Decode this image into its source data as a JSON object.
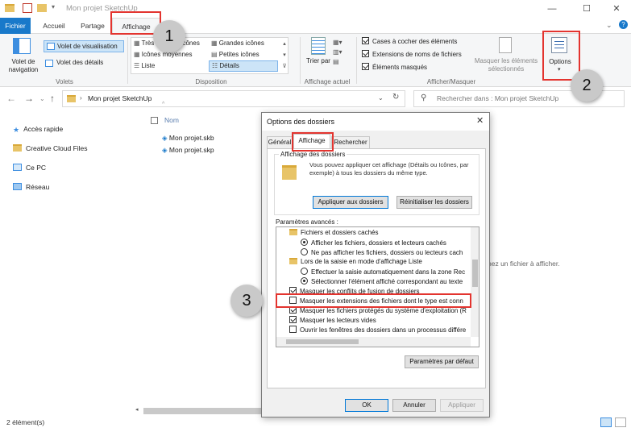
{
  "window": {
    "title": "Mon projet SketchUp",
    "controls": [
      "—",
      "☐",
      "✕"
    ]
  },
  "tabs": [
    "Fichier",
    "Accueil",
    "Partage",
    "Affichage"
  ],
  "ribbon": {
    "volets": {
      "navigation": "Volet de navigation",
      "visualisation": "Volet de visualisation",
      "details": "Volet des détails",
      "group": "Volets"
    },
    "disposition": {
      "items": [
        "Très grandes icônes",
        "Grandes icônes",
        "Icônes moyennes",
        "Petites icônes",
        "Liste",
        "Détails"
      ],
      "group": "Disposition"
    },
    "affichage_actuel": {
      "trier": "Trier par",
      "group": "Affichage actuel"
    },
    "afficher_masquer": {
      "cases": "Cases à cocher des éléments",
      "extensions": "Extensions de noms de fichiers",
      "masques": "Éléments masqués",
      "masquer_selection": "Masquer les éléments sélectionnés",
      "group": "Afficher/Masquer"
    },
    "options": "Options"
  },
  "address": {
    "path": "Mon projet SketchUp",
    "search_placeholder": "Rechercher dans : Mon projet SketchUp"
  },
  "nav": [
    "Accès rapide",
    "Creative Cloud Files",
    "Ce PC",
    "Réseau"
  ],
  "files": {
    "column": "Nom",
    "items": [
      "Mon projet.skb",
      "Mon projet.skp"
    ],
    "empty_hint": "nez un fichier à afficher."
  },
  "status": "2 élément(s)",
  "dialog": {
    "title": "Options des dossiers",
    "tabs": [
      "Général",
      "Affichage",
      "Rechercher"
    ],
    "folder_views_title": "Affichage des dossiers",
    "folder_views_text": "Vous pouvez appliquer cet affichage (Détails ou Icônes, par exemple) à tous les dossiers du même type.",
    "apply_button": "Appliquer aux dossiers",
    "reset_button": "Réinitialiser les dossiers",
    "advanced_label": "Paramètres avancés :",
    "advanced": [
      {
        "kind": "folder",
        "text": "Fichiers et dossiers cachés"
      },
      {
        "kind": "radio",
        "on": true,
        "text": "Afficher les fichiers, dossiers et lecteurs cachés"
      },
      {
        "kind": "radio",
        "on": false,
        "text": "Ne pas afficher les fichiers, dossiers ou lecteurs cach"
      },
      {
        "kind": "folder",
        "text": "Lors de la saisie en mode d'affichage Liste"
      },
      {
        "kind": "radio",
        "on": false,
        "text": "Effectuer la saisie automatiquement dans la zone Rec"
      },
      {
        "kind": "radio",
        "on": true,
        "text": "Sélectionner l'élément affiché correspondant au texte"
      },
      {
        "kind": "check",
        "on": true,
        "text": "Masquer les conflits de fusion de dossiers"
      },
      {
        "kind": "check",
        "on": false,
        "text": "Masquer les extensions des fichiers dont le type est conn"
      },
      {
        "kind": "check",
        "on": true,
        "text": "Masquer les fichiers protégés du système d'exploitation (R"
      },
      {
        "kind": "check",
        "on": true,
        "text": "Masquer les lecteurs vides"
      },
      {
        "kind": "check",
        "on": false,
        "text": "Ouvrir les fenêtres des dossiers dans un processus différe"
      }
    ],
    "defaults_button": "Paramètres par défaut",
    "ok": "OK",
    "cancel": "Annuler",
    "apply": "Appliquer"
  },
  "steps": [
    "1",
    "2",
    "3"
  ]
}
